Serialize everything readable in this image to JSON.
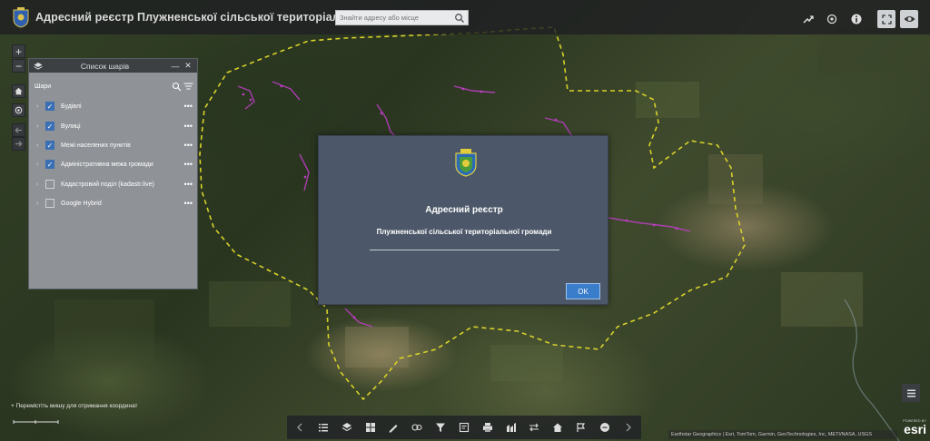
{
  "header": {
    "title": "Адресний реєстр Плужненської сільської територіальної громади",
    "search_placeholder": "Знайти адресу або місце",
    "icons": [
      "share-icon",
      "widget-icon",
      "info-icon",
      "fullscreen-icon",
      "eye-icon"
    ]
  },
  "map_controls": {
    "zoom_in": "+",
    "zoom_out": "−",
    "icons": [
      "home-icon",
      "locate-icon",
      "back-arrow-icon",
      "forward-arrow-icon"
    ]
  },
  "layer_panel": {
    "title": "Список шарів",
    "layers_label": "Шари",
    "layers": [
      {
        "name": "Будівлі",
        "checked": true
      },
      {
        "name": "Вулиці",
        "checked": true
      },
      {
        "name": "Межі населених пунктів",
        "checked": true
      },
      {
        "name": "Адміністративна межа громади",
        "checked": true
      },
      {
        "name": "Кадастровий поділ (kadastr.live)",
        "checked": false
      },
      {
        "name": "Google Hybrid",
        "checked": false
      }
    ]
  },
  "modal": {
    "title": "Адресний реєстр",
    "subtitle": "Плужненської сільської територіальної громади",
    "ok_label": "OK"
  },
  "status": {
    "coordinate_hint": "Перемістіть мишу для отримання координат"
  },
  "attribution": "Earthstar Geographics | Esri, TomTom, Garmin, GeoTechnologies, Inc, METI/NASA, USGS",
  "esri_label": "esri",
  "esri_powered": "POWERED BY",
  "colors": {
    "header_bg": "#1e2022",
    "panel_bg": "#8f9297",
    "modal_bg": "#4c5869",
    "ok_button": "#3a7dca",
    "checkbox_on": "#3a6fb4",
    "boundary": "#d8d12a",
    "buildings": "#c03ec8"
  }
}
